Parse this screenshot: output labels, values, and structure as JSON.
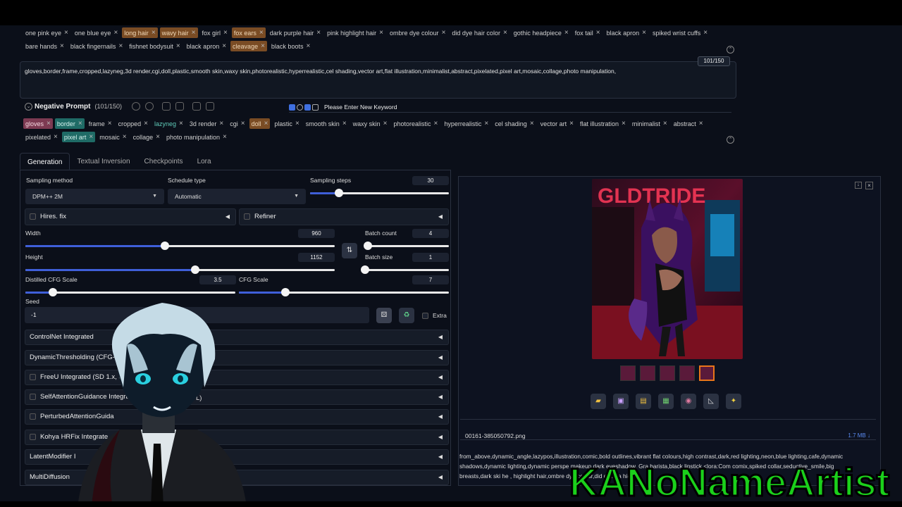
{
  "positive_tags_row1": [
    {
      "label": "one pink eye",
      "hl": ""
    },
    {
      "label": "one blue eye",
      "hl": ""
    },
    {
      "label": "long hair",
      "hl": "orange"
    },
    {
      "label": "wavy hair",
      "hl": "orange"
    },
    {
      "label": "fox girl",
      "hl": ""
    },
    {
      "label": "fox ears",
      "hl": "orange"
    },
    {
      "label": "dark purple hair",
      "hl": ""
    },
    {
      "label": "pink highlight hair",
      "hl": ""
    },
    {
      "label": "ombre dye colour",
      "hl": ""
    },
    {
      "label": "did dye hair color",
      "hl": ""
    },
    {
      "label": "gothic headpiece",
      "hl": ""
    },
    {
      "label": "fox tail",
      "hl": ""
    },
    {
      "label": "black apron",
      "hl": ""
    },
    {
      "label": "spiked wrist cuffs",
      "hl": ""
    }
  ],
  "positive_tags_row2": [
    {
      "label": "bare hands",
      "hl": ""
    },
    {
      "label": "black fingernails",
      "hl": ""
    },
    {
      "label": "fishnet bodysuit",
      "hl": ""
    },
    {
      "label": "black apron",
      "hl": ""
    },
    {
      "label": "cleavage",
      "hl": "orange"
    },
    {
      "label": "black boots",
      "hl": ""
    }
  ],
  "negative_prompt": {
    "text": "gloves,border,frame,cropped,lazyneg,3d render,cgi,doll,plastic,smooth skin,waxy skin,photorealistic,hyperrealistic,cel shading,vector art,flat illustration,minimalist,abstract,pixelated,pixel art,mosaic,collage,photo manipulation,",
    "counter": "101/150",
    "title": "Negative Prompt",
    "count_label": "(101/150)",
    "keyword_placeholder": "Please Enter New Keyword"
  },
  "negative_tags_row1": [
    {
      "label": "gloves",
      "hl": "pink"
    },
    {
      "label": "border",
      "hl": "teal"
    },
    {
      "label": "frame",
      "hl": ""
    },
    {
      "label": "cropped",
      "hl": ""
    },
    {
      "label": "lazyneg",
      "hl": "tealtext"
    },
    {
      "label": "3d render",
      "hl": ""
    },
    {
      "label": "cgi",
      "hl": ""
    },
    {
      "label": "doll",
      "hl": "orange"
    },
    {
      "label": "plastic",
      "hl": ""
    },
    {
      "label": "smooth skin",
      "hl": ""
    },
    {
      "label": "waxy skin",
      "hl": ""
    },
    {
      "label": "photorealistic",
      "hl": ""
    },
    {
      "label": "hyperrealistic",
      "hl": ""
    },
    {
      "label": "cel shading",
      "hl": ""
    },
    {
      "label": "vector art",
      "hl": ""
    },
    {
      "label": "flat illustration",
      "hl": ""
    },
    {
      "label": "minimalist",
      "hl": ""
    },
    {
      "label": "abstract",
      "hl": ""
    }
  ],
  "negative_tags_row2": [
    {
      "label": "pixelated",
      "hl": ""
    },
    {
      "label": "pixel art",
      "hl": "teal"
    },
    {
      "label": "mosaic",
      "hl": ""
    },
    {
      "label": "collage",
      "hl": ""
    },
    {
      "label": "photo manipulation",
      "hl": ""
    }
  ],
  "tabs": [
    "Generation",
    "Textual Inversion",
    "Checkpoints",
    "Lora"
  ],
  "generation": {
    "sampling_method_label": "Sampling method",
    "sampling_method": "DPM++ 2M",
    "schedule_type_label": "Schedule type",
    "schedule_type": "Automatic",
    "sampling_steps_label": "Sampling steps",
    "sampling_steps": "30",
    "hires_label": "Hires. fix",
    "refiner_label": "Refiner",
    "width_label": "Width",
    "width": "960",
    "height_label": "Height",
    "height": "1152",
    "batch_count_label": "Batch count",
    "batch_count": "4",
    "batch_size_label": "Batch size",
    "batch_size": "1",
    "distilled_cfg_label": "Distilled CFG Scale",
    "distilled_cfg": "3.5",
    "cfg_label": "CFG Scale",
    "cfg": "7",
    "seed_label": "Seed",
    "seed": "-1",
    "extra_label": "Extra",
    "accordions": [
      {
        "label": "ControlNet Integrated",
        "checkbox": false
      },
      {
        "label": "DynamicThresholding (CFG-F",
        "checkbox": false
      },
      {
        "label": "FreeU Integrated (SD 1.x, S",
        "checkbox": true
      },
      {
        "label": "SelfAttentionGuidance Integrat",
        "checkbox": true
      },
      {
        "label": "PerturbedAttentionGuida",
        "checkbox": true
      },
      {
        "label": "Kohya HRFix Integrate",
        "checkbox": true
      },
      {
        "label": "LatentModifier I",
        "checkbox": false
      },
      {
        "label": "MultiDiffusion",
        "checkbox": false
      }
    ],
    "partial_text_fragment": "L)"
  },
  "slider_levels": {
    "sampling_steps": 0.21,
    "width": 0.45,
    "height": 0.55,
    "batch_count": 0.03,
    "batch_size": 0.0,
    "distilled_cfg": 0.13,
    "cfg": 0.22
  },
  "output": {
    "filename": "00161-385050792.png",
    "filesize": "1.7 MB ↓",
    "info": "from_above,dynamic_angle,lazypos,illustration,comic,bold outlines,vibrant flat colours,high contrast,dark,red lighting,neon,blue lighting,cafe,dynamic shadows,dynamic lighting,dynamic perspe      makeup,dark eyeshadow,  Gra       barista,black lipstick,<lora:Com      comix,spiked collar,seductive_smile,big breasts,dark ski    he   ,  highlight hair,ombre dye colour,did dye ha     hic he",
    "image_sign_text": "GLDTRIDE"
  },
  "watermark": "KANoNameArtist",
  "colors": {
    "accent": "#3f5fd9",
    "orange_tag": "#7a4c24",
    "teal_tag": "#1f6b66",
    "pink_tag": "#7d3a52",
    "bg": "#0b0f19"
  }
}
